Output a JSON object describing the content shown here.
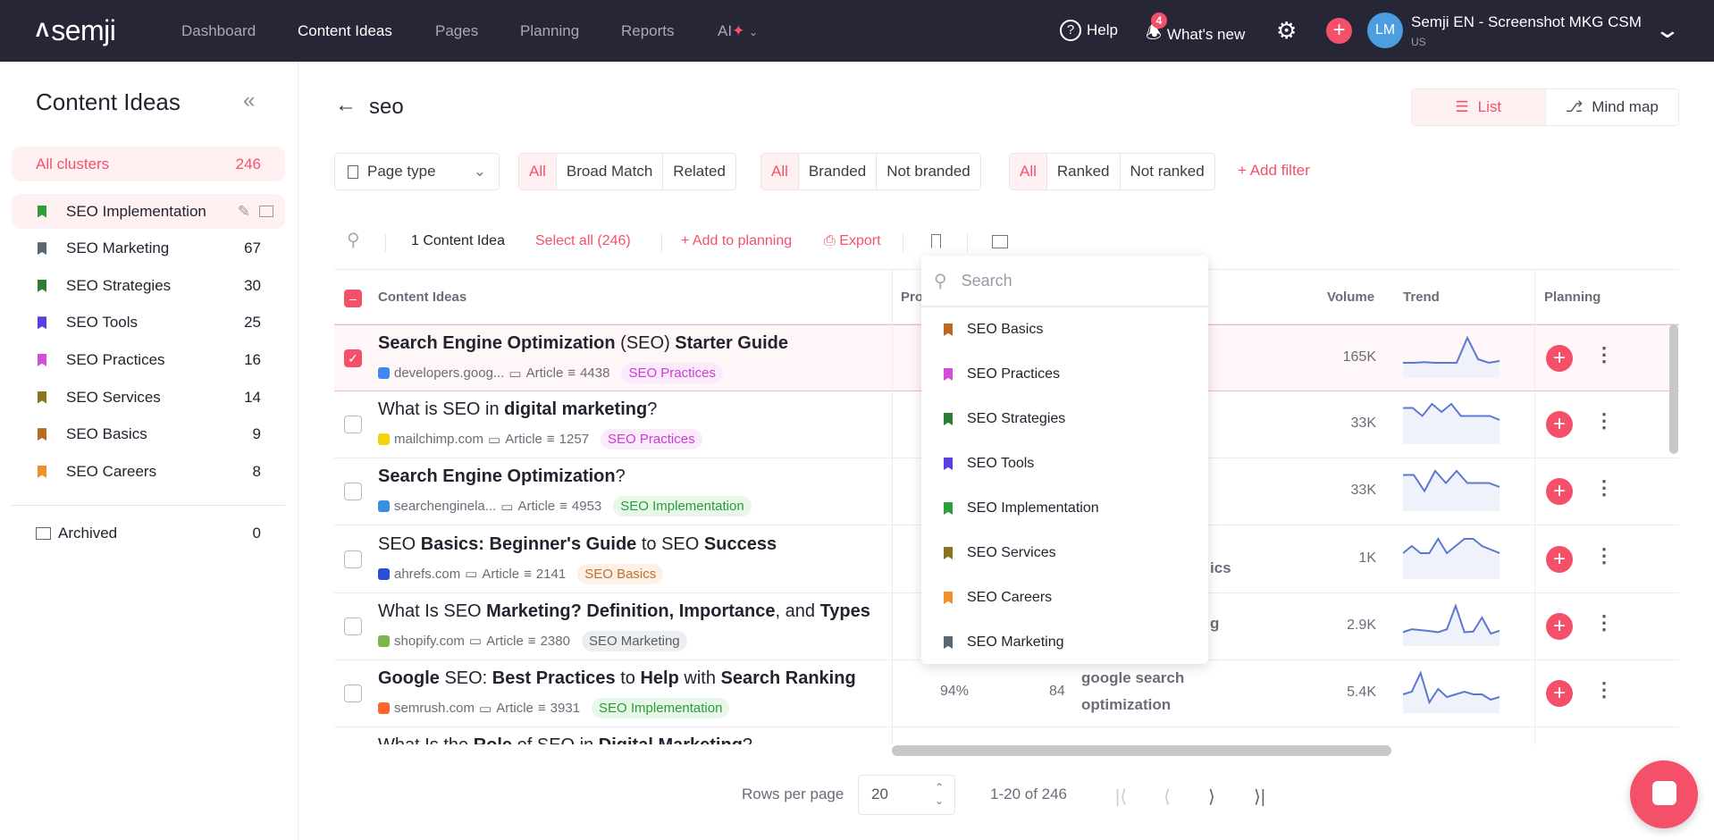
{
  "topbar": {
    "logo": "semji",
    "nav": [
      "Dashboard",
      "Content Ideas",
      "Pages",
      "Planning",
      "Reports",
      "AI"
    ],
    "active": "Content Ideas",
    "help": "Help",
    "whats_new": "What's new",
    "notif_count": "4",
    "avatar_initials": "LM",
    "workspace": "Semji EN - Screenshot MKG CSM",
    "locale": "US"
  },
  "sidebar": {
    "title": "Content Ideas",
    "all_clusters": {
      "label": "All clusters",
      "count": "246"
    },
    "clusters": [
      {
        "label": "SEO Implementation",
        "count": "",
        "color": "#2e9e3a",
        "selected": true
      },
      {
        "label": "SEO Marketing",
        "count": "67",
        "color": "#5b6770"
      },
      {
        "label": "SEO Strategies",
        "count": "30",
        "color": "#2f7d34"
      },
      {
        "label": "SEO Tools",
        "count": "25",
        "color": "#5a3fe0"
      },
      {
        "label": "SEO Practices",
        "count": "16",
        "color": "#d04fd6"
      },
      {
        "label": "SEO Services",
        "count": "14",
        "color": "#8a7424"
      },
      {
        "label": "SEO Basics",
        "count": "9",
        "color": "#b86a25"
      },
      {
        "label": "SEO Careers",
        "count": "8",
        "color": "#f0922a"
      }
    ],
    "archived": {
      "label": "Archived",
      "count": "0"
    }
  },
  "main": {
    "title": "seo",
    "views": {
      "list": "List",
      "mindmap": "Mind map"
    },
    "filters": {
      "page_type": "Page type",
      "match": [
        "All",
        "Broad Match",
        "Related"
      ],
      "brand": [
        "All",
        "Branded",
        "Not branded"
      ],
      "rank": [
        "All",
        "Ranked",
        "Not ranked"
      ],
      "add": "+ Add filter"
    },
    "toolbar": {
      "count": "1 Content Idea",
      "select_all": "Select all (246)",
      "add_planning": "+ Add to planning",
      "export": "Export"
    },
    "columns": {
      "ideas": "Content Ideas",
      "pro": "Pro",
      "volume": "Volume",
      "trend": "Trend",
      "planning": "Planning"
    },
    "rows": [
      {
        "title": [
          {
            "t": "Search Engine Optimization",
            "b": true
          },
          {
            "t": " (SEO) "
          },
          {
            "t": "Starter Guide",
            "b": true
          }
        ],
        "domain": "developers.goog...",
        "fav": "#4285f4",
        "type": "Article",
        "words": "4438",
        "tag": "SEO Practices",
        "tag_c": "#c93fd0",
        "tag_bg": "#fbeafc",
        "volume": "165K",
        "trend": [
          2,
          2,
          2.2,
          2,
          2,
          2,
          9,
          3,
          2,
          2.5
        ],
        "checked": true
      },
      {
        "title": [
          {
            "t": "What is SEO in "
          },
          {
            "t": "digital marketing",
            "b": true
          },
          {
            "t": "?"
          }
        ],
        "domain": "mailchimp.com",
        "fav": "#f5d20b",
        "type": "Article",
        "words": "1257",
        "tag": "SEO Practices",
        "tag_c": "#c93fd0",
        "tag_bg": "#fbeafc",
        "volume": "33K",
        "trend": [
          7,
          7,
          5,
          8,
          6,
          8,
          5,
          5,
          5,
          5,
          4
        ]
      },
      {
        "title": [
          {
            "t": "Search Engine Optimization",
            "b": true
          },
          {
            "t": "?"
          }
        ],
        "domain": "searchenginela...",
        "fav": "#3a8de0",
        "type": "Article",
        "words": "4953",
        "tag": "SEO Implementation",
        "tag_c": "#2a9a3a",
        "tag_bg": "#e8f8e8",
        "volume": "33K",
        "trend": [
          7,
          7,
          3,
          8,
          5,
          8,
          5,
          5,
          5,
          4
        ]
      },
      {
        "title": [
          {
            "t": "SEO "
          },
          {
            "t": "Basics: Beginner's Guide",
            "b": true
          },
          {
            "t": " to SEO "
          },
          {
            "t": "Success",
            "b": true
          }
        ],
        "domain": "ahrefs.com",
        "fav": "#2c4bd8",
        "type": "Article",
        "words": "2141",
        "tag": "SEO Basics",
        "tag_c": "#c0712a",
        "tag_bg": "#fdf0e6",
        "volume": "1K",
        "trend": [
          5,
          7,
          5,
          5,
          9,
          5,
          7,
          9,
          9,
          7,
          6,
          5
        ],
        "kw": "ics"
      },
      {
        "title": [
          {
            "t": "What Is SEO "
          },
          {
            "t": "Marketing? Definition, Importance",
            "b": true
          },
          {
            "t": ", and "
          },
          {
            "t": "Types",
            "b": true
          }
        ],
        "domain": "shopify.com",
        "fav": "#7ab648",
        "type": "Article",
        "words": "2380",
        "tag": "SEO Marketing",
        "tag_c": "#555e68",
        "tag_bg": "#eceef0",
        "volume": "2.9K",
        "trend": [
          2,
          3,
          2.7,
          2.4,
          2,
          3,
          11,
          2,
          2.2,
          7,
          1.5,
          2.5
        ],
        "kw": "g"
      },
      {
        "title": [
          {
            "t": "Google",
            "b": true
          },
          {
            "t": " SEO: "
          },
          {
            "t": "Best Practices",
            "b": true
          },
          {
            "t": " to "
          },
          {
            "t": "Help",
            "b": true
          },
          {
            "t": " with "
          },
          {
            "t": "Search Ranking",
            "b": true
          }
        ],
        "domain": "semrush.com",
        "fav": "#ff642d",
        "type": "Article",
        "words": "3931",
        "tag": "SEO Implementation",
        "tag_c": "#2a9a3a",
        "tag_bg": "#e8f8e8",
        "volume": "5.4K",
        "trend": [
          4,
          5,
          12,
          1,
          6,
          3,
          4,
          5,
          4,
          4,
          2,
          3
        ],
        "pro": "94%",
        "score": "84",
        "kw": "google search optimization"
      },
      {
        "title": [
          {
            "t": "What Is the "
          },
          {
            "t": "Role",
            "b": true
          },
          {
            "t": " of SEO in "
          },
          {
            "t": "Digital Marketing",
            "b": true
          },
          {
            "t": "?"
          }
        ]
      }
    ],
    "pagination": {
      "rows_label": "Rows per page",
      "rows_value": "20",
      "range": "1-20 of 246"
    }
  },
  "dropdown": {
    "placeholder": "Search",
    "items": [
      {
        "label": "SEO Basics",
        "color": "#b86a25"
      },
      {
        "label": "SEO Practices",
        "color": "#d04fd6"
      },
      {
        "label": "SEO Strategies",
        "color": "#2f7d34"
      },
      {
        "label": "SEO Tools",
        "color": "#5a3fe0"
      },
      {
        "label": "SEO Implementation",
        "color": "#2e9e3a"
      },
      {
        "label": "SEO Services",
        "color": "#8a7424"
      },
      {
        "label": "SEO Careers",
        "color": "#f0922a"
      },
      {
        "label": "SEO Marketing",
        "color": "#5b6770"
      }
    ]
  },
  "colors": {
    "accent": "#f5506a",
    "topbar": "#262637",
    "trend_line": "#5b78d0"
  }
}
